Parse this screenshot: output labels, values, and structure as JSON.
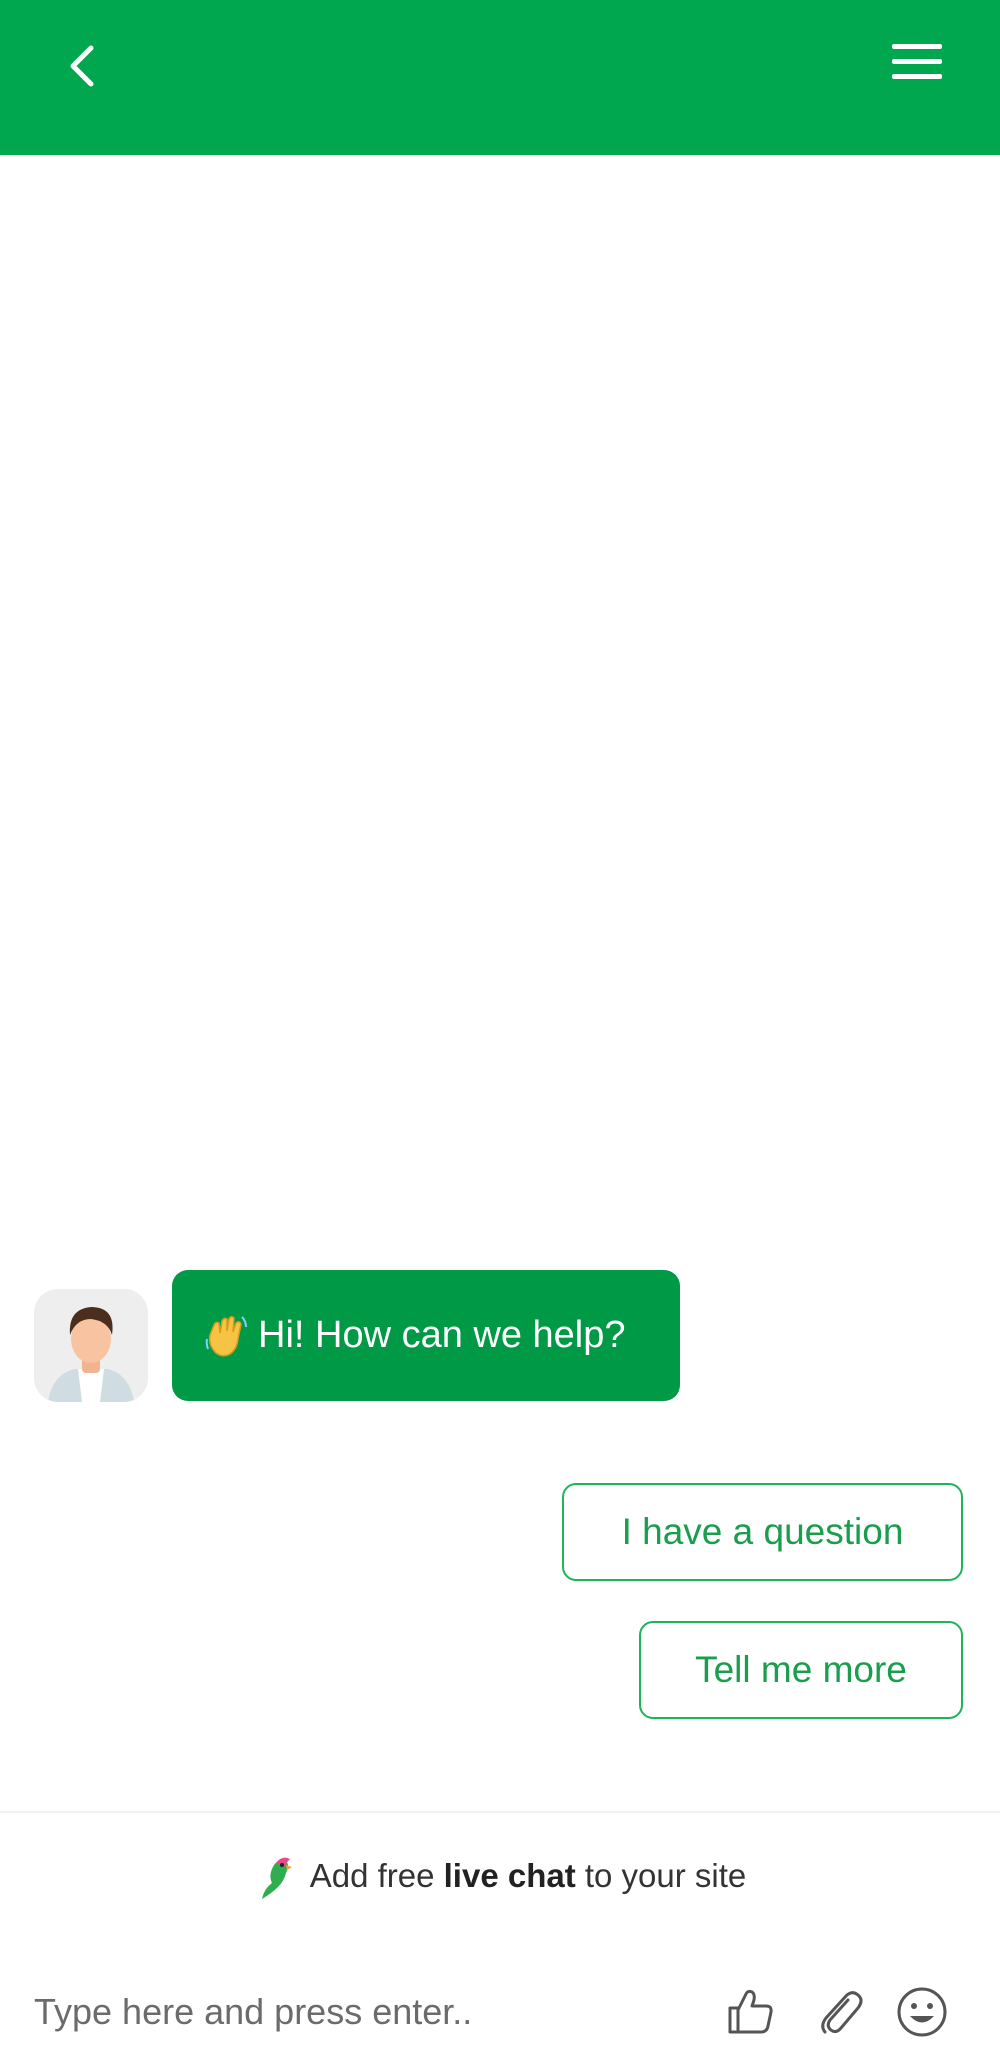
{
  "header": {
    "back_icon": "chevron-left-icon",
    "menu_icon": "hamburger-menu-icon",
    "background": "#00a74f"
  },
  "conversation": {
    "agent_avatar": "agent-avatar",
    "greeting": {
      "emoji_icon": "waving-hand-icon",
      "text": "Hi! How can we help?",
      "background": "#009945"
    },
    "quick_replies": [
      {
        "label": "I have a question"
      },
      {
        "label": "Tell me more"
      }
    ]
  },
  "footer": {
    "promo": {
      "icon": "parrot-logo-icon",
      "prefix": "Add free ",
      "bold": "live chat",
      "suffix": " to your site"
    },
    "composer": {
      "placeholder": "Type here and press enter..",
      "value": ""
    },
    "tools": [
      "thumbs-up-icon",
      "paperclip-icon",
      "smiley-icon"
    ]
  },
  "colors": {
    "accent": "#00a74f",
    "bubble": "#009945",
    "quick_reply_text": "#1a9e4e"
  }
}
